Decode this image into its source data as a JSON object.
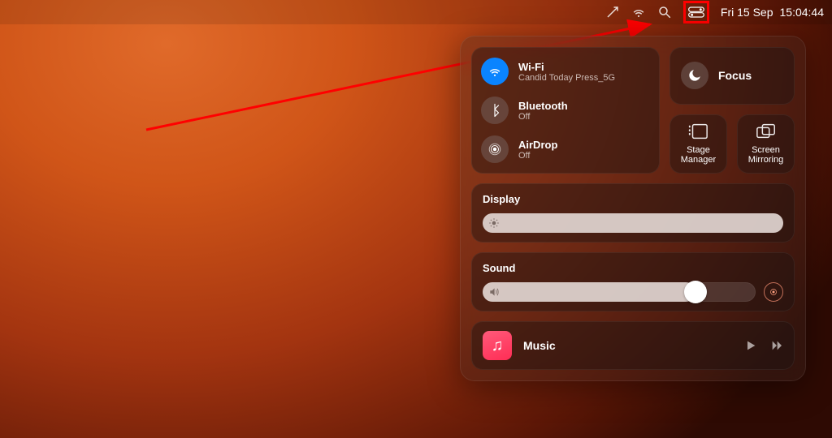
{
  "menubar": {
    "date": "Fri 15 Sep",
    "time": "15:04:44"
  },
  "controlCenter": {
    "wifi": {
      "title": "Wi-Fi",
      "subtitle": "Candid Today Press_5G",
      "on": true
    },
    "bluetooth": {
      "title": "Bluetooth",
      "subtitle": "Off",
      "on": false
    },
    "airdrop": {
      "title": "AirDrop",
      "subtitle": "Off",
      "on": false
    },
    "focus": {
      "title": "Focus"
    },
    "stageManager": {
      "label": "Stage\nManager"
    },
    "screenMirroring": {
      "label": "Screen\nMirroring"
    },
    "display": {
      "label": "Display",
      "value": 100
    },
    "sound": {
      "label": "Sound",
      "value": 78
    },
    "music": {
      "title": "Music"
    }
  }
}
